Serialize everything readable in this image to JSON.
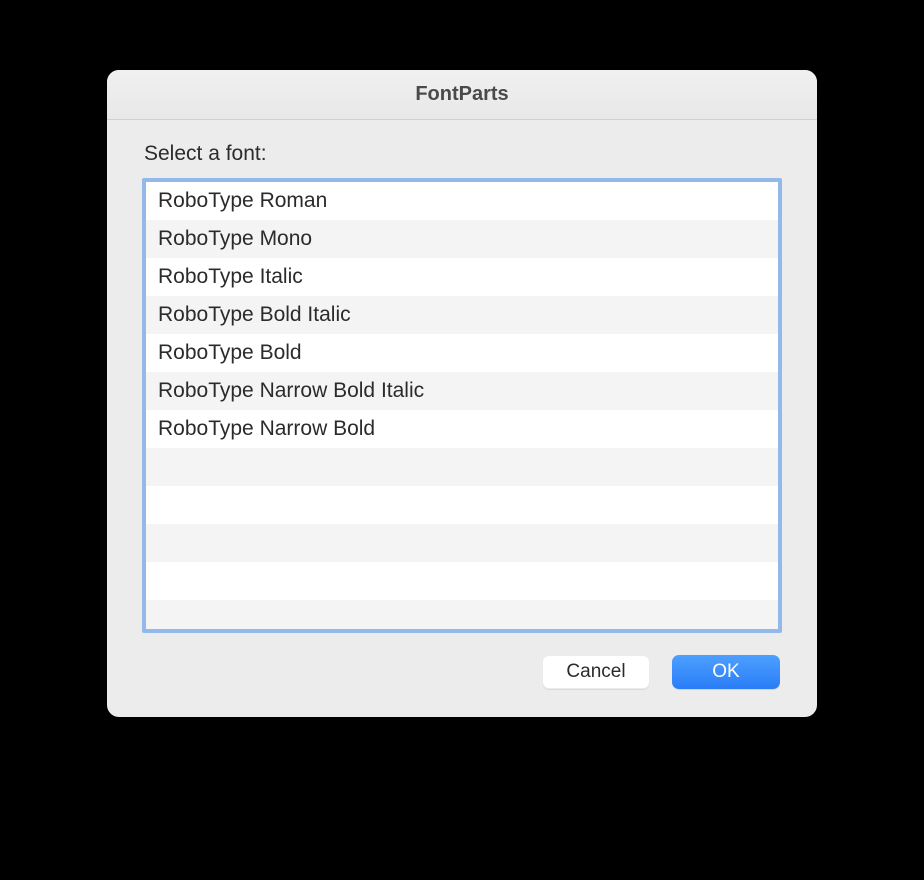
{
  "window": {
    "title": "FontParts"
  },
  "prompt": {
    "label": "Select a font:"
  },
  "fonts": {
    "visible_rows": 12,
    "items": [
      "RoboType Roman",
      "RoboType Mono",
      "RoboType Italic",
      "RoboType Bold Italic",
      "RoboType Bold",
      "RoboType Narrow Bold Italic",
      "RoboType Narrow Bold"
    ]
  },
  "buttons": {
    "cancel": "Cancel",
    "ok": "OK"
  },
  "colors": {
    "focus_ring": "#93b8ea",
    "primary_button": "#2a7df7",
    "window_bg": "#ececec"
  }
}
